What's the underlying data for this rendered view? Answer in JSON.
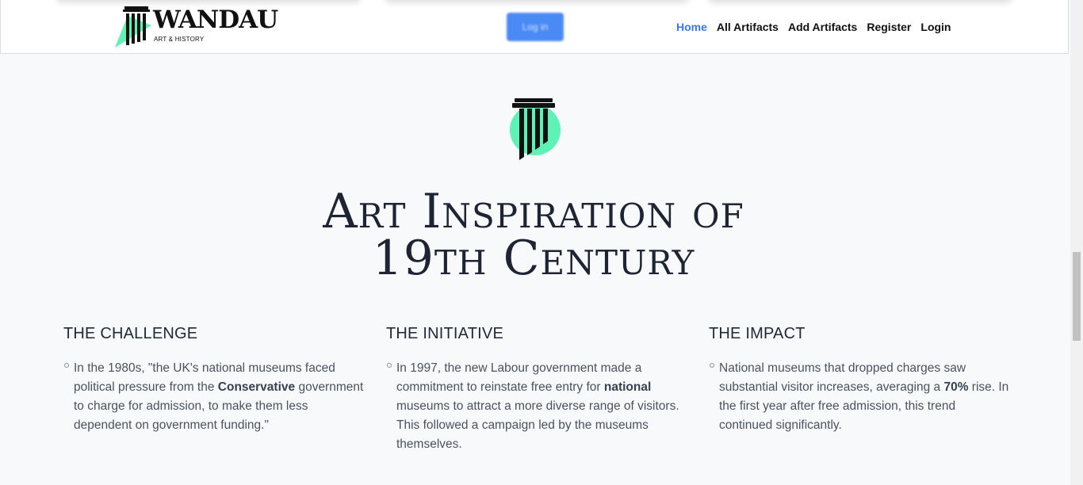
{
  "header": {
    "logo": {
      "title": "WANDAU",
      "subtitle": "ART & HISTORY"
    },
    "cta_label": "Log in",
    "nav": [
      "Home",
      "All Artifacts",
      "Add Artifacts",
      "Register",
      "Login"
    ]
  },
  "hero": {
    "title_line1": "Art Inspiration of",
    "title_line2": "19th Century"
  },
  "sections": [
    {
      "heading": "THE CHALLENGE",
      "text_1": "In the 1980s, \"the UK's national museums faced political pressure from the ",
      "bold": "Conservative",
      "text_2": " government to charge for admission, to make them less dependent on government funding.\""
    },
    {
      "heading": "THE INITIATIVE",
      "text_1": "In 1997, the new Labour government made a commitment to reinstate free entry for ",
      "bold": "national",
      "text_2": " museums to attract a more diverse range of visitors. This followed a campaign led by the museums themselves."
    },
    {
      "heading": "THE IMPACT",
      "text_1": "National museums that dropped charges saw substantial visitor increases, averaging a ",
      "bold": "70%",
      "text_2": " rise. In the first year after free admission, this trend continued significantly."
    }
  ],
  "colors": {
    "accent": "#3b76f6",
    "mint": "#5ef2b6",
    "background": "#f8f9fb",
    "title": "#1e2433"
  },
  "icons": [
    "column-logo-icon",
    "column-emblem-icon",
    "bullet-icon"
  ]
}
